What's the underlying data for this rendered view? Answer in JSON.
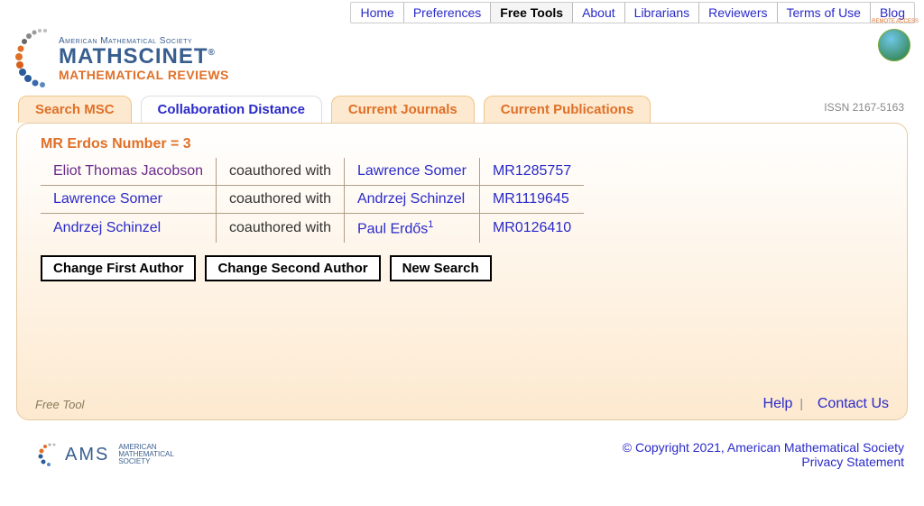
{
  "topnav": {
    "items": [
      {
        "label": "Home"
      },
      {
        "label": "Preferences"
      },
      {
        "label": "Free Tools",
        "active": true
      },
      {
        "label": "About"
      },
      {
        "label": "Librarians"
      },
      {
        "label": "Reviewers"
      },
      {
        "label": "Terms of Use"
      },
      {
        "label": "Blog"
      }
    ]
  },
  "brand": {
    "society": "American Mathematical Society",
    "line1": "MATHSCINET",
    "line2": "MATHEMATICAL REVIEWS",
    "remote_access": "Remote Access"
  },
  "tabs": {
    "items": [
      {
        "label": "Search MSC"
      },
      {
        "label": "Collaboration Distance",
        "active": true
      },
      {
        "label": "Current Journals"
      },
      {
        "label": "Current Publications"
      }
    ],
    "issn": "ISSN 2167-5163"
  },
  "result": {
    "heading": "MR Erdos Number = 3",
    "rows": [
      {
        "a": "Eliot Thomas Jacobson",
        "a_visited": true,
        "mid": "coauthored with",
        "b": "Lawrence Somer",
        "mr": "MR1285757"
      },
      {
        "a": "Lawrence Somer",
        "mid": "coauthored with",
        "b": "Andrzej Schinzel",
        "mr": "MR1119645"
      },
      {
        "a": "Andrzej Schinzel",
        "mid": "coauthored with",
        "b": "Paul Erdős",
        "b_sup": "1",
        "mr": "MR0126410"
      }
    ],
    "buttons": {
      "change_first": "Change First Author",
      "change_second": "Change Second Author",
      "new_search": "New Search"
    }
  },
  "panel_footer": {
    "left": "Free Tool",
    "help": "Help",
    "contact": "Contact Us"
  },
  "page_footer": {
    "ams": "AMS",
    "ams_sub": "American\nMathematical\nSociety",
    "copyright": "© Copyright 2021, American Mathematical Society",
    "privacy": "Privacy Statement"
  }
}
